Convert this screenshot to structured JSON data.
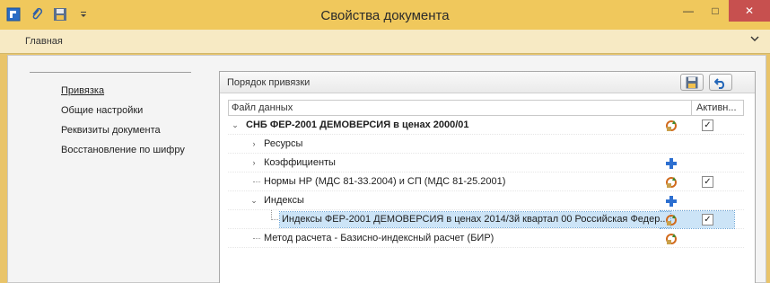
{
  "window": {
    "title": "Свойства документа"
  },
  "ribbon": {
    "tab_main": "Главная"
  },
  "nav": {
    "items": [
      {
        "label": "Привязка",
        "active": true
      },
      {
        "label": "Общие настройки",
        "active": false
      },
      {
        "label": "Реквизиты документа",
        "active": false
      },
      {
        "label": "Восстановление по шифру",
        "active": false
      }
    ]
  },
  "panel": {
    "title": "Порядок привязки",
    "columns": {
      "file": "Файл данных",
      "active": "Активн..."
    },
    "rows": [
      {
        "label": "СНБ ФЕР-2001 ДЕМОВЕРСИЯ в ценах 2000/01",
        "bold": true,
        "icon": "refresh-icon",
        "checked": true
      },
      {
        "label": "Ресурсы",
        "icon": "",
        "checked": false
      },
      {
        "label": "Коэффициенты",
        "icon": "plus-icon",
        "checked": false
      },
      {
        "label": "Нормы НР (МДС 81-33.2004) и СП (МДС 81-25.2001)",
        "icon": "refresh-icon",
        "checked": true
      },
      {
        "label": "Индексы",
        "icon": "plus-icon",
        "checked": false
      },
      {
        "label": "Индексы ФЕР-2001 ДЕМОВЕРСИЯ в ценах 2014/3й квартал 00 Российская Федер...",
        "icon": "refresh-icon",
        "checked": true,
        "selected": true
      },
      {
        "label": "Метод расчета - Базисно-индексный расчет (БИР)",
        "icon": "refresh-icon",
        "checked": false
      }
    ],
    "check_mark": "✓"
  },
  "colors": {
    "titlebar": "#f0c85c",
    "close": "#c7504f",
    "selection": "#cce4f7"
  }
}
